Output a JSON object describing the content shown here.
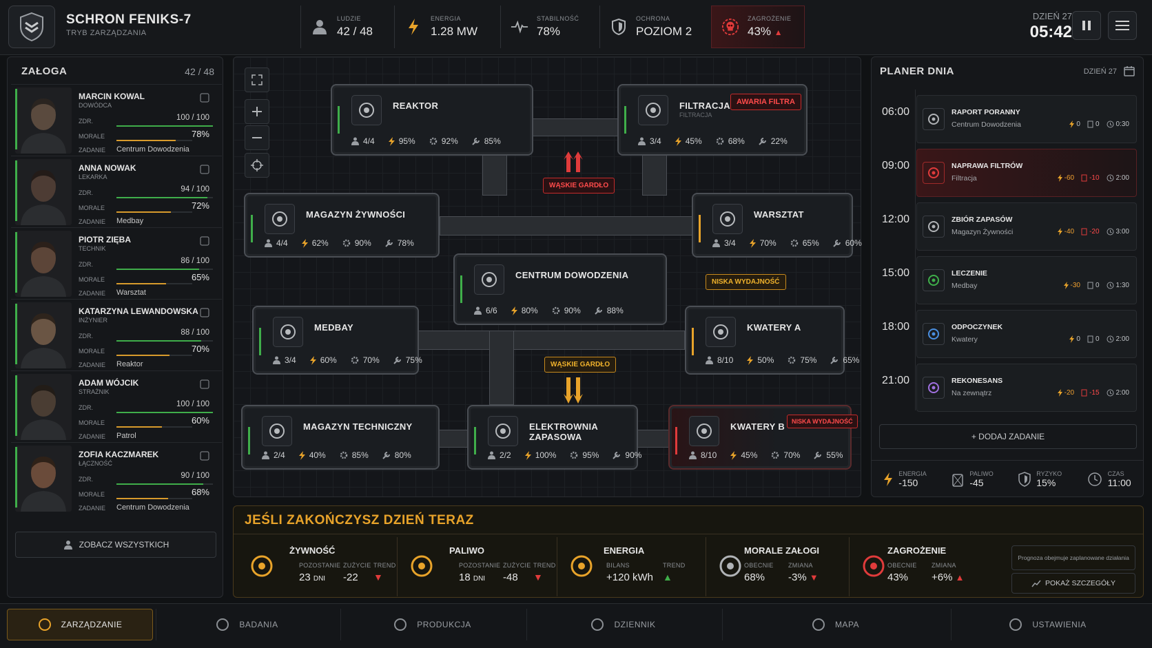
{
  "header": {
    "title": "SCHRON FENIKS-7",
    "subtitle": "TRYB ZARZĄDZANIA",
    "day": "DZIEŃ 27",
    "time": "05:42",
    "stats": [
      {
        "label": "LUDZIE",
        "value": "42 / 48",
        "icon": "person-icon"
      },
      {
        "label": "ENERGIA",
        "value": "1.28 MW",
        "icon": "lightning-icon"
      },
      {
        "label": "STABILNOŚĆ",
        "value": "78%",
        "icon": "pulse-icon"
      },
      {
        "label": "OCHRONA",
        "value": "POZIOM 2",
        "icon": "shield-icon"
      },
      {
        "label": "ZAGROŻENIE",
        "value": "43%",
        "icon": "skull-icon"
      }
    ]
  },
  "crew": {
    "title": "ZAŁOGA",
    "count": "42 / 48",
    "view_all": "ZOBACZ WSZYSTKICH",
    "health_label": "ZDR.",
    "morale_label": "MORALE",
    "task_label": "ZADANIE",
    "members": [
      {
        "name": "MARCIN KOWAL",
        "role": "DOWÓDCA",
        "health": "100 / 100",
        "health_pct": 100,
        "morale": "78%",
        "morale_pct": 78,
        "task": "Centrum Dowodzenia"
      },
      {
        "name": "ANNA NOWAK",
        "role": "LEKARKA",
        "health": "94 / 100",
        "health_pct": 94,
        "morale": "72%",
        "morale_pct": 72,
        "task": "Medbay"
      },
      {
        "name": "PIOTR ZIĘBA",
        "role": "TECHNIK",
        "health": "86 / 100",
        "health_pct": 86,
        "morale": "65%",
        "morale_pct": 65,
        "task": "Warsztat"
      },
      {
        "name": "KATARZYNA LEWANDOWSKA",
        "role": "INŻYNIER",
        "health": "88 / 100",
        "health_pct": 88,
        "morale": "70%",
        "morale_pct": 70,
        "task": "Reaktor"
      },
      {
        "name": "ADAM WÓJCIK",
        "role": "STRAŻNIK",
        "health": "100 / 100",
        "health_pct": 100,
        "morale": "60%",
        "morale_pct": 60,
        "task": "Patrol"
      },
      {
        "name": "ZOFIA KACZMAREK",
        "role": "ŁĄCZNOŚĆ",
        "health": "90 / 100",
        "health_pct": 90,
        "morale": "68%",
        "morale_pct": 68,
        "task": "Centrum Dowodzenia"
      }
    ]
  },
  "map": {
    "rooms": {
      "reaktor": {
        "name": "REAKTOR",
        "s": [
          "4/4",
          "95%",
          "92%",
          "85%"
        ]
      },
      "filtracja": {
        "name": "FILTRACJA",
        "sub": "FILTRACJA",
        "s": [
          "3/4",
          "45%",
          "68%",
          "22%"
        ],
        "tag": "AWARIA FILTRA"
      },
      "magazyn": {
        "name": "MAGAZYN ŻYWNOŚCI",
        "s": [
          "4/4",
          "62%",
          "90%",
          "78%"
        ]
      },
      "warsztat": {
        "name": "WARSZTAT",
        "s": [
          "3/4",
          "70%",
          "65%",
          "60%"
        ]
      },
      "centrum": {
        "name": "CENTRUM DOWODZENIA",
        "s": [
          "6/6",
          "80%",
          "90%",
          "88%"
        ],
        "tag": "NISKA WYDAJNOŚĆ"
      },
      "medbay": {
        "name": "MEDBAY",
        "s": [
          "3/4",
          "60%",
          "70%",
          "75%"
        ]
      },
      "kwateryA": {
        "name": "KWATERY A",
        "s": [
          "8/10",
          "50%",
          "75%",
          "65%"
        ]
      },
      "techniczny": {
        "name": "MAGAZYN TECHNICZNY",
        "s": [
          "2/4",
          "40%",
          "85%",
          "80%"
        ]
      },
      "elektrownia": {
        "name": "ELEKTROWNIA ZAPASOWA",
        "s": [
          "2/2",
          "100%",
          "95%",
          "90%"
        ]
      },
      "kwateryB": {
        "name": "KWATERY B",
        "s": [
          "8/10",
          "45%",
          "70%",
          "55%"
        ],
        "tag": "NISKA WYDAJNOŚĆ"
      }
    },
    "bottleneck1": "WĄSKIE GARDŁO",
    "bottleneck2": "WĄSKIE GARDŁO"
  },
  "planner": {
    "title": "PLANER DNIA",
    "day": "DZIEŃ 27",
    "add": "+ DODAJ ZADANIE",
    "items": [
      {
        "time": "06:00",
        "name": "RAPORT PORANNY",
        "loc": "Centrum Dowodzenia",
        "e": "0",
        "f": "0",
        "t": "0:30"
      },
      {
        "time": "09:00",
        "name": "NAPRAWA FILTRÓW",
        "loc": "Filtracja",
        "e": "-60",
        "f": "-10",
        "t": "2:00"
      },
      {
        "time": "12:00",
        "name": "ZBIÓR ZAPASÓW",
        "loc": "Magazyn Żywności",
        "e": "-40",
        "f": "-20",
        "t": "3:00"
      },
      {
        "time": "15:00",
        "name": "LECZENIE",
        "loc": "Medbay",
        "e": "-30",
        "f": "0",
        "t": "1:30"
      },
      {
        "time": "18:00",
        "name": "ODPOCZYNEK",
        "loc": "Kwatery",
        "e": "0",
        "f": "0",
        "t": "2:00"
      },
      {
        "time": "21:00",
        "name": "REKONESANS",
        "loc": "Na zewnątrz",
        "e": "-20",
        "f": "-15",
        "t": "2:00"
      }
    ],
    "summary": [
      {
        "label": "ENERGIA",
        "value": "-150"
      },
      {
        "label": "PALIWO",
        "value": "-45"
      },
      {
        "label": "RYZYKO",
        "value": "15%"
      },
      {
        "label": "CZAS",
        "value": "11:00"
      }
    ]
  },
  "forecast": {
    "title": "JEŚLI ZAKOŃCZYSZ DZIEŃ TERAZ",
    "note": "Prognoza obejmuje zaplanowane działania",
    "details": "POKAŻ SZCZEGÓŁY",
    "food": {
      "title": "ŻYWNOŚĆ",
      "l1": "POZOSTANIE",
      "l2": "ZUŻYCIE",
      "l3": "TREND",
      "v1": "23",
      "v1u": "DNI",
      "v2": "-22"
    },
    "fuel": {
      "title": "PALIWO",
      "l1": "POZOSTANIE",
      "l2": "ZUŻYCIE",
      "l3": "TREND",
      "v1": "18",
      "v1u": "DNI",
      "v2": "-48"
    },
    "energy": {
      "title": "ENERGIA",
      "l1": "BILANS",
      "l2": "TREND",
      "v1": "+120 kWh"
    },
    "morale": {
      "title": "MORALE ZAŁOGI",
      "l1": "OBECNIE",
      "l2": "ZMIANA",
      "v1": "68%",
      "v2": "-3%"
    },
    "threat": {
      "title": "ZAGROŻENIE",
      "l1": "OBECNIE",
      "l2": "ZMIANA",
      "v1": "43%",
      "v2": "+6%"
    }
  },
  "nav": [
    "ZARZĄDZANIE",
    "BADANIA",
    "PRODUKCJA",
    "DZIENNIK",
    "MAPA",
    "USTAWIENIA"
  ]
}
